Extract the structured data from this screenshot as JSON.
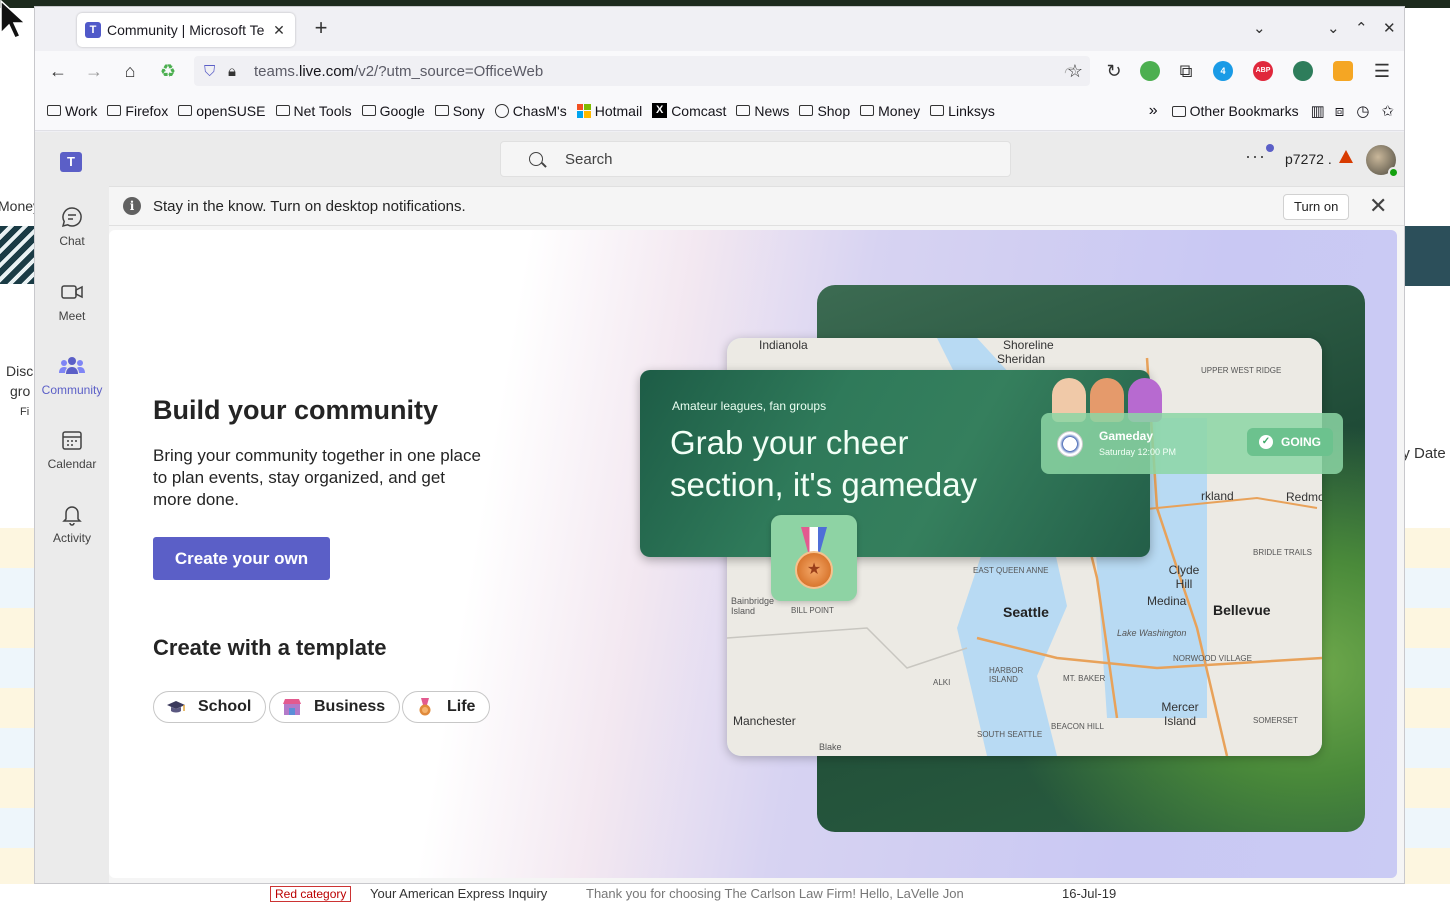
{
  "browser": {
    "tab_title": "Community | Microsoft Te",
    "url_prefix": "teams.",
    "url_domain": "live.com",
    "url_path": "/v2/?utm_source=OfficeWeb",
    "extension_badge": "4",
    "abp_label": "ABP",
    "bookmarks": [
      {
        "label": "Work",
        "icon": "folder-icon"
      },
      {
        "label": "Firefox",
        "icon": "folder-icon"
      },
      {
        "label": "openSUSE",
        "icon": "folder-icon"
      },
      {
        "label": "Net Tools",
        "icon": "folder-icon"
      },
      {
        "label": "Google",
        "icon": "folder-icon"
      },
      {
        "label": "Sony",
        "icon": "folder-icon"
      },
      {
        "label": "ChasM's",
        "icon": "globe-icon"
      },
      {
        "label": "Hotmail",
        "icon": "microsoft-icon"
      },
      {
        "label": "Comcast",
        "icon": "x-icon"
      },
      {
        "label": "News",
        "icon": "folder-icon"
      },
      {
        "label": "Shop",
        "icon": "folder-icon"
      },
      {
        "label": "Money",
        "icon": "folder-icon"
      },
      {
        "label": "Linksys",
        "icon": "folder-icon"
      }
    ],
    "other_bookmarks": "Other Bookmarks"
  },
  "teams": {
    "logo": "T",
    "rail": [
      {
        "label": "Chat",
        "icon": "chat-icon"
      },
      {
        "label": "Meet",
        "icon": "video-icon"
      },
      {
        "label": "Community",
        "icon": "community-icon",
        "active": true
      },
      {
        "label": "Calendar",
        "icon": "calendar-icon"
      },
      {
        "label": "Activity",
        "icon": "bell-icon"
      }
    ],
    "search_placeholder": "Search",
    "more": "···",
    "user": "p7272 .",
    "notification": {
      "text": "Stay in the know. Turn on desktop notifications.",
      "button": "Turn on"
    },
    "main": {
      "heading": "Build your community",
      "body": "Bring your community together in one place to plan events, stay organized, and get more done.",
      "create_button": "Create your own",
      "template_heading": "Create with a template",
      "templates": [
        "School",
        "Business",
        "Life"
      ],
      "hero": {
        "kicker": "Amateur leagues, fan groups",
        "headline": "Grab your cheer section, it's gameday",
        "event_title": "Gameday",
        "event_time": "Saturday 12:00 PM",
        "going": "GOING",
        "map_labels": [
          "Indianola",
          "Shoreline",
          "Sheridan",
          "UPPER WEST RIDGE",
          "rkland",
          "Redmond",
          "BRIDLE TRAILS",
          "Clyde Hill",
          "Medina",
          "Bellevue",
          "EAST QUEEN ANNE",
          "Seattle",
          "Bainbridge Island",
          "BILL POINT",
          "Lake Washington",
          "NORWOOD VILLAGE",
          "ALKI",
          "HARBOR ISLAND",
          "MT. BAKER",
          "Mercer Island",
          "SOMERSET",
          "Manchester",
          "BEACON HILL",
          "SOUTH SEATTLE",
          "Blake"
        ]
      }
    }
  },
  "background": {
    "left_text_1": "Money",
    "left_text_2": "Disc",
    "left_text_3": "gro",
    "left_text_4": "Fi",
    "right_text": "ly Date",
    "bottom_category": "Red category",
    "bottom_subject": "Your American Express Inquiry",
    "bottom_preview": "Thank you for choosing The Carlson Law Firm! Hello, LaVelle Jon",
    "bottom_date": "16-Jul-19"
  }
}
